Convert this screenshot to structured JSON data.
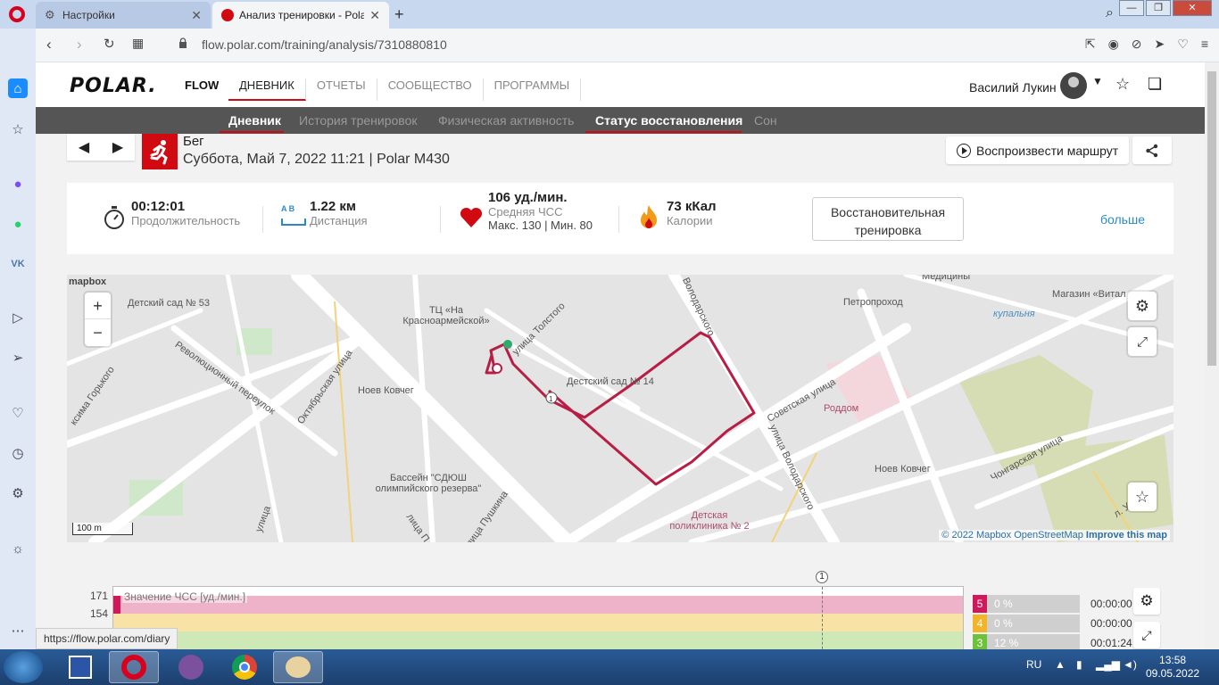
{
  "browser": {
    "tabs": [
      {
        "label": "Настройки",
        "icon": "gear-icon",
        "active": false
      },
      {
        "label": "Анализ тренировки - Polar",
        "icon": "polar-icon",
        "active": true
      }
    ],
    "url": "flow.polar.com/training/analysis/7310880810",
    "status_url": "https://flow.polar.com/diary"
  },
  "header": {
    "logo": "POLAR.",
    "product": "FLOW",
    "nav": [
      "ДНЕВНИК",
      "ОТЧЕТЫ",
      "СООБЩЕСТВО",
      "ПРОГРАММЫ"
    ],
    "active_nav": "ДНЕВНИК",
    "user": "Василий Лукин"
  },
  "subnav": {
    "items": [
      "Дневник",
      "История тренировок",
      "Физическая активность",
      "Статус восстановления",
      "Сон"
    ],
    "active": [
      "Дневник",
      "Статус восстановления"
    ]
  },
  "session": {
    "sport": "Бег",
    "datetime": "Суббота, Май 7, 2022 11:21 | Polar M430",
    "play_route": "Воспроизвести маршрут"
  },
  "summary": {
    "duration": {
      "value": "00:12:01",
      "label": "Продолжительность"
    },
    "distance": {
      "value": "1.22 км",
      "label": "Дистанция",
      "ab": "A    B"
    },
    "hr": {
      "value": "106 уд./мин.",
      "label": "Средняя ЧСС",
      "minmax": "Макс. 130  |  Мин. 80"
    },
    "calories": {
      "value": "73 кКал",
      "label": "Калории"
    },
    "recovery_btn": "Восстановительная тренировка",
    "more": "больше"
  },
  "map": {
    "labels": [
      "Детский сад № 53",
      "ТЦ «На Красноармейской»",
      "улица Толстого",
      "Дестский сад № 14",
      "Петропроход",
      "Медицины",
      "Магазин «Витал",
      "купальня",
      "Роддом",
      "Советская улица",
      "улица Володарского",
      "Володарского",
      "Ноев Ковчег",
      "Ноев Ковчег",
      "Октябрьская улица",
      "Революционный переулок",
      "ксима Горького",
      "Бассейн \"СДЮШ олимпийского резерва\"",
      "улица Пушкина",
      "лица П",
      "улица",
      "Детская поликлиника № 2",
      "Чонгарская улица",
      "л. Урицко"
    ],
    "scale": "100 m",
    "attribution": {
      "copyright": "© 2022",
      "mapbox": "Mapbox",
      "osm": "OpenStreetMap",
      "improve": "Improve this map"
    },
    "mapbox_logo": "mapbox"
  },
  "hr_chart": {
    "y_ticks": [
      "171",
      "154"
    ],
    "series_label": "Значение ЧСС [уд./мин.]",
    "marker": "1",
    "zones": [
      {
        "num": "5",
        "pct": "0 %",
        "time": "00:00:00",
        "color": "#d1185a"
      },
      {
        "num": "4",
        "pct": "0 %",
        "time": "00:00:00",
        "color": "#f2b52a"
      },
      {
        "num": "3",
        "pct": "12 %",
        "time": "00:01:24",
        "color": "#6cc23a"
      }
    ]
  },
  "taskbar": {
    "lang": "RU",
    "time": "13:58",
    "date": "09.05.2022"
  }
}
